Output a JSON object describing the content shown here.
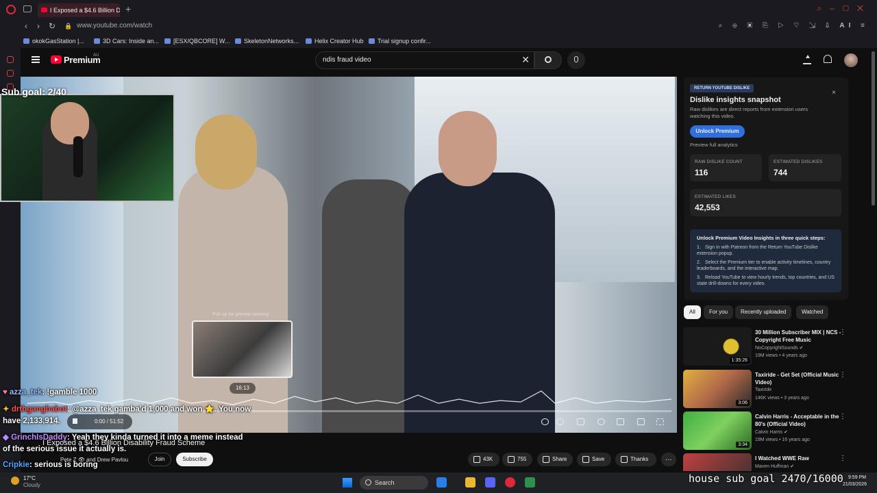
{
  "browser": {
    "tab_title": "I Exposed a $4.6 Billion Di",
    "new_tab": "+",
    "url": "www.youtube.com/watch",
    "bookmarks": [
      "okokGasStation |...",
      "3D Cars: Inside an...",
      "[ESX/QBCORE] W...",
      "SkeletonNetworks...",
      "Helix Creator Hub",
      "Trial signup confir..."
    ],
    "ai_label": "AI"
  },
  "youtube": {
    "brand": "Premium",
    "region": "AU",
    "search_value": "ndis fraud video",
    "clear_glyph": "✕"
  },
  "stream_overlay": {
    "sub_goal": "Sub goal: 2/40",
    "house_goal": "house sub goal 2470/16000",
    "chat": [
      {
        "user": "azza_tek",
        "text": ": !gamble 1000"
      },
      {
        "user": "drthgangbabot",
        "text": ": @azza_tek gamba'd 1,000 and won ⭐. You now"
      },
      {
        "user": "",
        "text": "have 2,133,914."
      },
      {
        "user": "GrinchIsDaddy",
        "text": ": Yeah they kinda turned it into a meme instead"
      },
      {
        "user": "",
        "text": "of the serious issue it actually is."
      },
      {
        "user": "Cripkie",
        "text": ": serious is boring"
      }
    ]
  },
  "player": {
    "preview_hint": "Pull up for precise seeking",
    "preview_time": "16:13",
    "time_display": "0:00 / 51:52",
    "progress_fraction": 0.003
  },
  "video": {
    "title": "I Exposed a $4.6 Billion Disability Fraud Scheme",
    "channel": "Pete Z 👁 and Drew Pavlou",
    "join": "Join",
    "subscribe": "Subscribe",
    "likes": "43K",
    "dislikes": "755",
    "share": "Share",
    "save": "Save",
    "thanks": "Thanks",
    "more": "…"
  },
  "insights": {
    "badge": "RETURN YOUTUBE DISLIKE",
    "close": "×",
    "title": "Dislike insights snapshot",
    "description": "Raw dislikes are direct reports from extension users watching this video.",
    "unlock_button": "Unlock Premium",
    "preview_link": "Preview full analytics",
    "stats": [
      {
        "label": "RAW DISLIKE COUNT",
        "value": "116"
      },
      {
        "label": "ESTIMATED DISLIKES",
        "value": "744"
      },
      {
        "label": "ESTIMATED LIKES",
        "value": "42,553"
      }
    ],
    "steps_title": "Unlock Premium Video Insights in three quick steps:",
    "steps": [
      "Sign in with Patreon from the Return YouTube Dislike extension popup.",
      "Select the Premium tier to enable activity timelines, country leaderboards, and the interactive map.",
      "Reload YouTube to view hourly trends, top countries, and US state drill-downs for every video."
    ]
  },
  "chips": [
    "All",
    "For you",
    "Recently uploaded",
    "Watched"
  ],
  "recommendations": [
    {
      "title": "30 Million Subscriber MIX | NCS - Copyright Free Music",
      "channel": "NoCopyrightSounds ✔",
      "meta": "19M views • 4 years ago",
      "duration": "1:35:26"
    },
    {
      "title": "Taxiride - Get Set (Official Music Video)",
      "channel": "Taxiride",
      "meta": "146K views • 3 years ago",
      "duration": "3:06"
    },
    {
      "title": "Calvin Harris - Acceptable in the 80's (Official Video)",
      "channel": "Calvin Harris ✔",
      "meta": "19M views • 16 years ago",
      "duration": "3:34"
    },
    {
      "title": "I Watched WWE Raw",
      "channel": "Maven Huffman ✔",
      "meta": "",
      "duration": ""
    }
  ],
  "taskbar": {
    "temp": "17°C",
    "weather": "Cloudy",
    "search": "Search",
    "time": "9:59 PM",
    "date": "21/03/2026"
  }
}
